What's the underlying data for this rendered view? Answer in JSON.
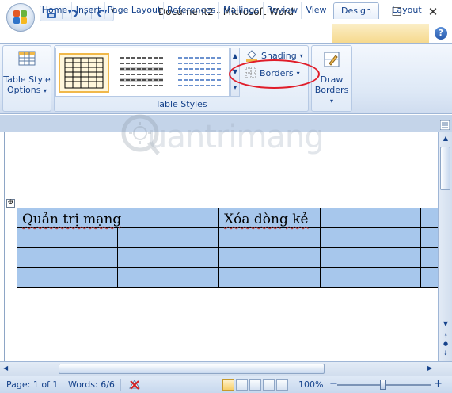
{
  "window": {
    "title": "Document2 - Microsoft Word",
    "controls": {
      "minimize": "—",
      "maximize": "☐",
      "close": "✕"
    }
  },
  "quick_access": {
    "more": "▾",
    "icons": [
      "save-icon",
      "undo-icon",
      "redo-icon"
    ]
  },
  "tabs": [
    {
      "label": "Home",
      "active": false
    },
    {
      "label": "Insert",
      "active": false
    },
    {
      "label": "Page Layout",
      "active": false
    },
    {
      "label": "References",
      "active": false
    },
    {
      "label": "Mailings",
      "active": false
    },
    {
      "label": "Review",
      "active": false
    },
    {
      "label": "View",
      "active": false
    },
    {
      "label": "Design",
      "active": true
    },
    {
      "label": "Layout",
      "active": false
    }
  ],
  "help": "?",
  "ribbon": {
    "table_style_options": {
      "line1": "Table Style",
      "line2": "Options"
    },
    "table_styles": {
      "group_label": "Table Styles"
    },
    "shading": {
      "label": "Shading"
    },
    "borders": {
      "label": "Borders"
    },
    "draw_borders": {
      "line1": "Draw",
      "line2": "Borders"
    }
  },
  "watermark": {
    "text": "uantrimang"
  },
  "document": {
    "table": {
      "rows": [
        [
          "Quản trị mạng",
          "",
          "Xóa dòng kẻ",
          "",
          ""
        ],
        [
          "",
          "",
          "",
          "",
          ""
        ],
        [
          "",
          "",
          "",
          "",
          ""
        ],
        [
          "",
          "",
          "",
          "",
          ""
        ]
      ]
    }
  },
  "status": {
    "page": "Page: 1 of 1",
    "words": "Words: 6/6",
    "zoom": "100%",
    "zoom_minus": "−",
    "zoom_plus": "+"
  },
  "colors": {
    "ribbon_text": "#15428b",
    "table_fill": "#a7c7ec",
    "highlight": "#e01d2a",
    "contextual_tab": "#f6d98d"
  }
}
